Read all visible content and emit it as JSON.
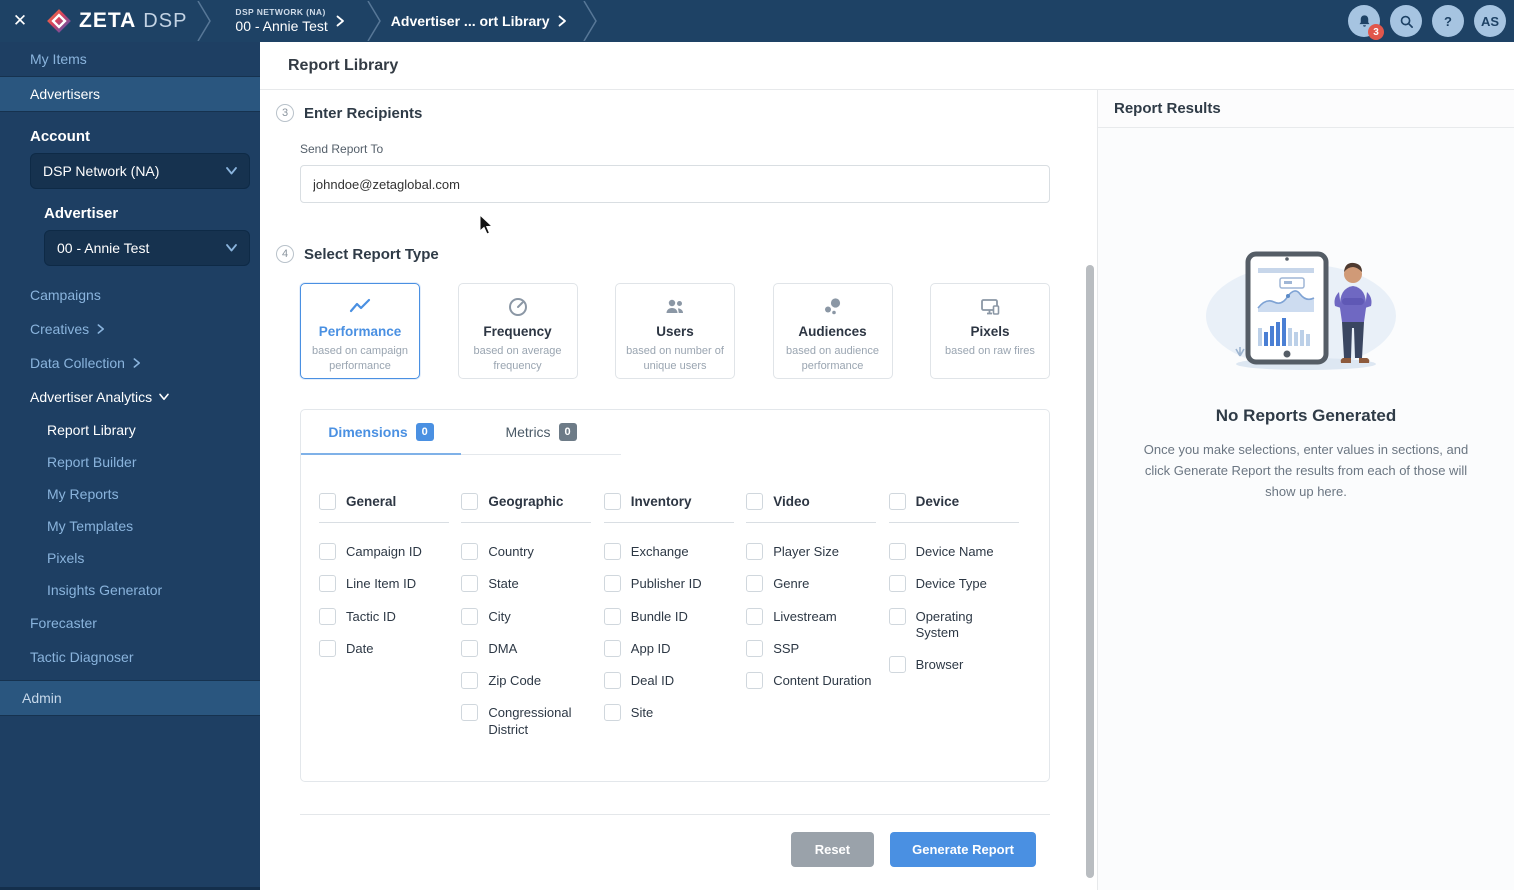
{
  "colors": {
    "accent": "#4a90e2",
    "topbar_bg": "#1e4265",
    "sidebar_bg": "#1e3f63",
    "highlight_row": "#2a567f",
    "notification_red": "#e1574c",
    "reset_grey": "#9aa2aa"
  },
  "topbar": {
    "close": "✕",
    "brand_zeta": "ZETA",
    "brand_dsp": "DSP",
    "crumb1_eyebrow": "DSP NETWORK (NA)",
    "crumb1_label": "00 - Annie Test",
    "crumb2_label": "Advertiser ... ort Library",
    "notifications_count": "3",
    "help_symbol": "?",
    "avatar_initials": "AS"
  },
  "sidebar": {
    "my_items": "My Items",
    "advertisers": "Advertisers",
    "account_label": "Account",
    "account_value": "DSP Network (NA)",
    "advertiser_label": "Advertiser",
    "advertiser_value": "00 - Annie Test",
    "campaigns": "Campaigns",
    "creatives": "Creatives",
    "data_collection": "Data Collection",
    "advertiser_analytics": "Advertiser Analytics",
    "analytics_items": [
      "Report Library",
      "Report Builder",
      "My Reports",
      "My Templates",
      "Pixels",
      "Insights Generator"
    ],
    "forecaster": "Forecaster",
    "tactic_diagnoser": "Tactic Diagnoser",
    "admin": "Admin"
  },
  "main": {
    "page_title": "Report Library",
    "step3": {
      "number": "3",
      "title": "Enter Recipients",
      "field_label": "Send Report To",
      "field_value": "johndoe@zetaglobal.com"
    },
    "step4": {
      "number": "4",
      "title": "Select Report Type",
      "cards": [
        {
          "title": "Performance",
          "subtitle": "based on campaign performance",
          "selected": true
        },
        {
          "title": "Frequency",
          "subtitle": "based on average frequency",
          "selected": false
        },
        {
          "title": "Users",
          "subtitle": "based on number of unique users",
          "selected": false
        },
        {
          "title": "Audiences",
          "subtitle": "based on audience performance",
          "selected": false
        },
        {
          "title": "Pixels",
          "subtitle": "based on raw fires",
          "selected": false
        }
      ]
    },
    "tabs": {
      "dimensions_label": "Dimensions",
      "dimensions_count": "0",
      "metrics_label": "Metrics",
      "metrics_count": "0"
    },
    "dimensions_columns": [
      {
        "header": "General",
        "items": [
          "Campaign ID",
          "Line Item ID",
          "Tactic ID",
          "Date"
        ]
      },
      {
        "header": "Geographic",
        "items": [
          "Country",
          "State",
          "City",
          "DMA",
          "Zip Code",
          "Congressional District"
        ]
      },
      {
        "header": "Inventory",
        "items": [
          "Exchange",
          "Publisher ID",
          "Bundle ID",
          "App ID",
          "Deal ID",
          "Site"
        ]
      },
      {
        "header": "Video",
        "items": [
          "Player Size",
          "Genre",
          "Livestream",
          "SSP",
          "Content Duration"
        ]
      },
      {
        "header": "Device",
        "items": [
          "Device Name",
          "Device Type",
          "Operating System",
          "Browser"
        ]
      }
    ],
    "buttons": {
      "reset": "Reset",
      "generate": "Generate Report"
    }
  },
  "results": {
    "title": "Report Results",
    "empty_title": "No Reports Generated",
    "empty_text": "Once you make selections, enter values in sections, and click Generate Report the results from each of those will show up here."
  }
}
